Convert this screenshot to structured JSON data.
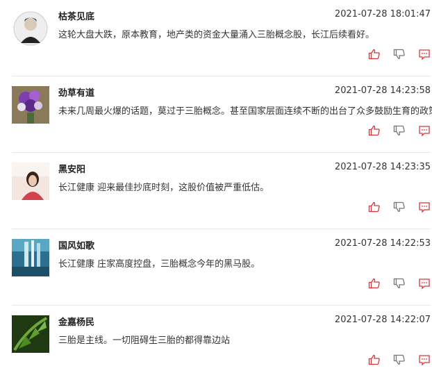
{
  "comments": [
    {
      "author": "枯茶见底",
      "time": "2021-07-28 18:01:47",
      "text": "这轮大盘大跌，原本教育，地产类的资金大量涌入三胎概念股，长江后续看好。"
    },
    {
      "author": "劲草有道",
      "time": "2021-07-28 14:23:58",
      "text": "未来几周最火爆的话题，莫过于三胎概念。甚至国家层面连续不断的出台了众多鼓励生育的政策"
    },
    {
      "author": "黑安阳",
      "time": "2021-07-28 14:23:35",
      "text": "长江健康 迎来最佳抄底时刻，这股价值被严重低估。"
    },
    {
      "author": "国风如歌",
      "time": "2021-07-28 14:22:53",
      "text": "长江健康 庄家高度控盘，三胎概念今年的黑马股。"
    },
    {
      "author": "金嘉杨民",
      "time": "2021-07-28 14:22:07",
      "text": "三胎是主线。一切阻碍生三胎的都得靠边站"
    }
  ],
  "icons": {
    "like": "thumbs-up-icon",
    "dislike": "thumbs-down-icon",
    "reply": "comment-icon"
  },
  "colors": {
    "accent": "#d8363a",
    "divider": "#e6e6e6"
  }
}
